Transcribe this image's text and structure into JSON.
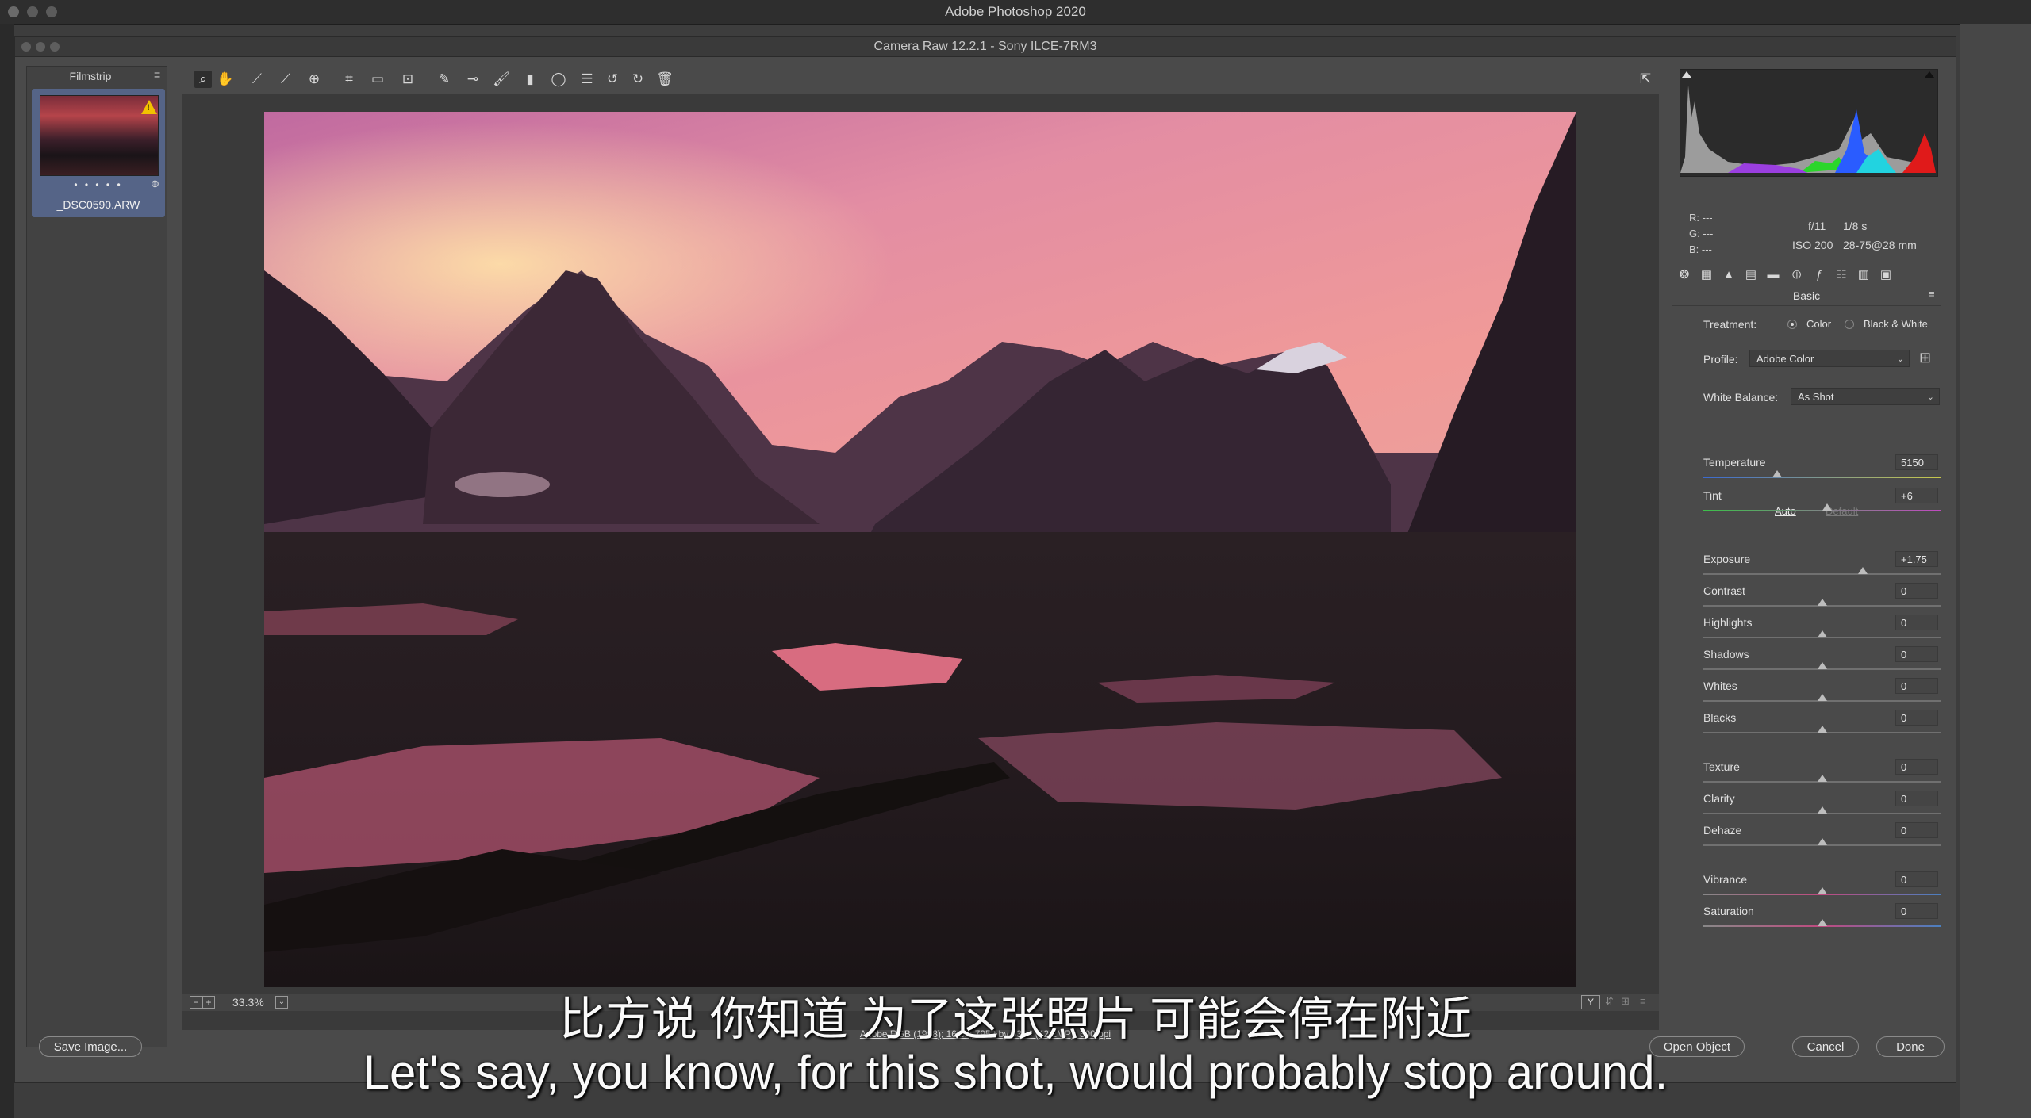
{
  "mac": {
    "title": "Adobe Photoshop 2020"
  },
  "dialog": {
    "title": "Camera Raw 12.2.1  -  Sony ILCE-7RM3"
  },
  "filmstrip": {
    "title": "Filmstrip",
    "thumbnail": {
      "filename": "_DSC0590.ARW",
      "rating_dots": "• • • • •",
      "warning": "!"
    }
  },
  "toolbar": {
    "tools": [
      "zoom-icon",
      "hand-icon",
      "white-balance-icon",
      "color-sampler-icon",
      "targeted-adjustment-icon",
      "crop-icon",
      "straighten-icon",
      "transform-icon",
      "spot-removal-icon",
      "red-eye-icon",
      "adjustment-brush-icon",
      "graduated-filter-icon",
      "radial-filter-icon",
      "presets-list-icon",
      "rotate-left-icon",
      "rotate-right-icon",
      "trash-icon"
    ]
  },
  "status": {
    "zoom": "33.3%",
    "workflow": "Adobe RGB (1998); 16 bit; 7952 by 5304 (42.2MP); 300 ppi"
  },
  "info": {
    "r": "R:   ---",
    "g": "G:   ---",
    "b": "B:   ---",
    "aperture": "f/11",
    "shutter": "1/8 s",
    "iso": "ISO 200",
    "lens": "28-75@28 mm"
  },
  "panel": {
    "title": "Basic",
    "treatment_label": "Treatment:",
    "treatment_color": "Color",
    "treatment_bw": "Black & White",
    "profile_label": "Profile:",
    "profile_value": "Adobe Color",
    "wb_label": "White Balance:",
    "wb_value": "As Shot",
    "auto": "Auto",
    "default": "Default",
    "sliders": [
      {
        "name": "Temperature",
        "value": "5150",
        "pos": 0.31
      },
      {
        "name": "Tint",
        "value": "+6",
        "pos": 0.52
      },
      {
        "name": "Exposure",
        "value": "+1.75",
        "pos": 0.67
      },
      {
        "name": "Contrast",
        "value": "0",
        "pos": 0.5
      },
      {
        "name": "Highlights",
        "value": "0",
        "pos": 0.5
      },
      {
        "name": "Shadows",
        "value": "0",
        "pos": 0.5
      },
      {
        "name": "Whites",
        "value": "0",
        "pos": 0.5
      },
      {
        "name": "Blacks",
        "value": "0",
        "pos": 0.5
      },
      {
        "name": "Texture",
        "value": "0",
        "pos": 0.5
      },
      {
        "name": "Clarity",
        "value": "0",
        "pos": 0.5
      },
      {
        "name": "Dehaze",
        "value": "0",
        "pos": 0.5
      },
      {
        "name": "Vibrance",
        "value": "0",
        "pos": 0.5
      },
      {
        "name": "Saturation",
        "value": "0",
        "pos": 0.5
      }
    ]
  },
  "buttons": {
    "save": "Save Image...",
    "open": "Open Object",
    "cancel": "Cancel",
    "done": "Done"
  },
  "subtitles": {
    "zh": "比方说 你知道 为了这张照片 可能会停在附近",
    "en": "Let's say, you know, for this shot, would probably stop around."
  },
  "colors": {
    "accent": "#556487",
    "warning": "#f2c200"
  }
}
